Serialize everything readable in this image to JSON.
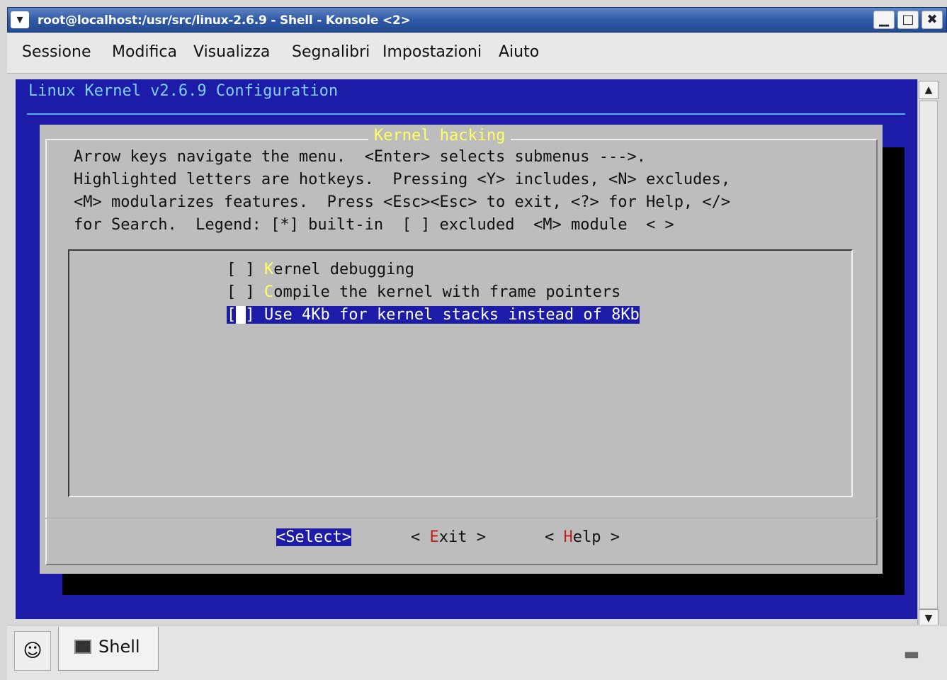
{
  "window": {
    "title": "root@localhost:/usr/src/linux-2.6.9 - Shell - Konsole <2>",
    "menu_icon": "▾",
    "min_symbol": "▁",
    "max_symbol": "□",
    "close_symbol": "✖"
  },
  "menubar": {
    "items": [
      "Sessione",
      "Modifica",
      "Visualizza",
      "Segnalibri",
      "Impostazioni",
      "Aiuto"
    ]
  },
  "terminal": {
    "header": "Linux Kernel v2.6.9 Configuration",
    "dialog_title": "Kernel hacking",
    "help_lines": [
      "Arrow keys navigate the menu.  <Enter> selects submenus --->.",
      "Highlighted letters are hotkeys.  Pressing <Y> includes, <N> excludes,",
      "<M> modularizes features.  Press <Esc><Esc> to exit, <?> for Help, </>",
      "for Search.  Legend: [*] built-in  [ ] excluded  <M> module  < >"
    ],
    "menu": [
      {
        "box": "[ ] ",
        "hotkey": "K",
        "rest": "ernel debugging"
      },
      {
        "box": "[ ] ",
        "hotkey": "C",
        "rest": "ompile the kernel with frame pointers"
      },
      {
        "box_open": "[",
        "cursor": " ",
        "box_close": "] ",
        "text": "Use 4Kb for kernel stacks instead of 8Kb",
        "selected": true
      }
    ],
    "buttons": {
      "select": "<Select>",
      "exit_pre": "< ",
      "exit_hotkey": "E",
      "exit_rest": "xit",
      "exit_post": " >",
      "help_pre": "< ",
      "help_hotkey": "H",
      "help_rest": "elp",
      "help_post": " >"
    }
  },
  "scrollbar": {
    "up_arrow": "▲",
    "down_arrow": "▼"
  },
  "tabbar": {
    "new_tab_icon": "☺",
    "tabs": [
      {
        "label": "Shell"
      }
    ],
    "close_tab_icon": "▬"
  }
}
